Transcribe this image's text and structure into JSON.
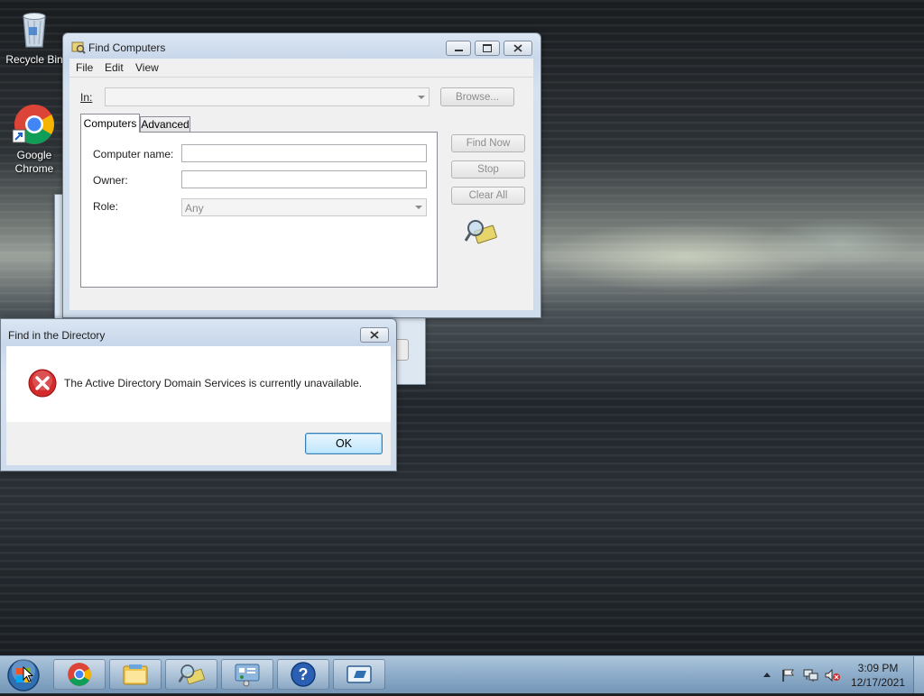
{
  "desktop": {
    "icons": [
      {
        "label": "Recycle Bin"
      },
      {
        "label": "Google\nChrome"
      }
    ]
  },
  "find_computers": {
    "title": "Find Computers",
    "menu": [
      "File",
      "Edit",
      "View"
    ],
    "in_label": "In:",
    "in_value": "",
    "browse_label": "Browse...",
    "tabs": [
      "Computers",
      "Advanced"
    ],
    "computer_name_label": "Computer name:",
    "computer_name_value": "",
    "owner_label": "Owner:",
    "owner_value": "",
    "role_label": "Role:",
    "role_value": "Any",
    "find_now_label": "Find Now",
    "stop_label": "Stop",
    "clear_all_label": "Clear All"
  },
  "error_dialog": {
    "title": "Find in the Directory",
    "message": "The Active Directory Domain Services is currently unavailable.",
    "ok_label": "OK",
    "icon": "error-icon"
  },
  "taskbar": {
    "buttons": [
      "start-orb",
      "chrome-icon",
      "file-explorer-icon",
      "find-icon",
      "control-panel-icon",
      "help-icon",
      "server-manager-icon"
    ],
    "clock_time": "3:09 PM",
    "clock_date": "12/17/2021"
  },
  "colors": {
    "accent_focus": "#3c7fb1",
    "error_red": "#d42a2a"
  }
}
